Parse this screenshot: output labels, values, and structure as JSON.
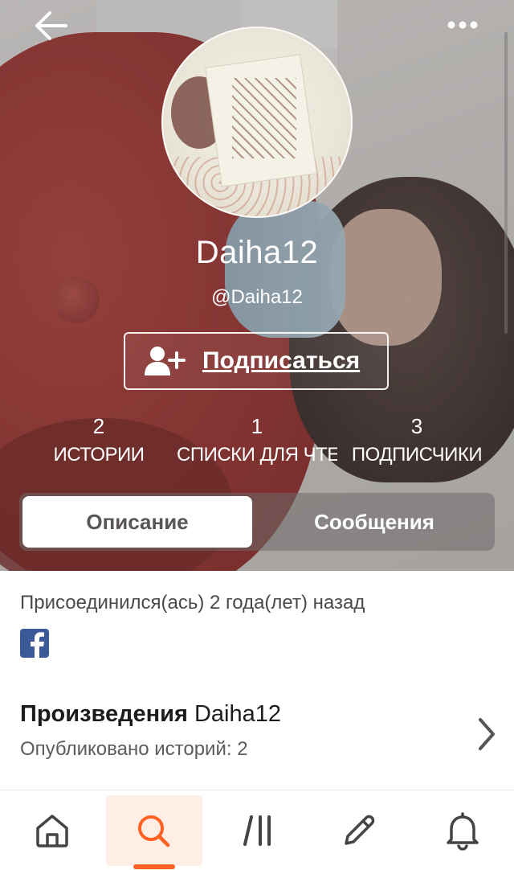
{
  "header": {
    "back_icon": "arrow-left-icon",
    "more_icon": "more-horizontal-icon"
  },
  "profile": {
    "display_name": "Daiha12",
    "handle": "@Daiha12",
    "avatar_icon": "avatar-image"
  },
  "follow_button": {
    "label": "Подписаться",
    "icon": "add-user-icon"
  },
  "stats": [
    {
      "value": "2",
      "label": "ИСТОРИИ"
    },
    {
      "value": "1",
      "label": "СПИСКИ ДЛЯ ЧТЕНИЯ"
    },
    {
      "value": "3",
      "label": "ПОДПИСЧИКИ"
    }
  ],
  "tabs": {
    "active": "Описание",
    "inactive": "Сообщения"
  },
  "about": {
    "joined": "Присоединился(ась) 2 года(лет) назад",
    "social_icon": "facebook-icon"
  },
  "works": {
    "title_bold": "Произведения",
    "title_name": "Daiha12",
    "published": "Опубликовано историй: 2"
  },
  "bottom_nav": {
    "items": [
      "home-icon",
      "search-icon",
      "library-icon",
      "write-icon",
      "bell-icon"
    ],
    "active": "search-icon"
  },
  "colors": {
    "accent": "#ff6122",
    "accent_bg": "#ffeee6",
    "facebook": "#3b5998"
  }
}
